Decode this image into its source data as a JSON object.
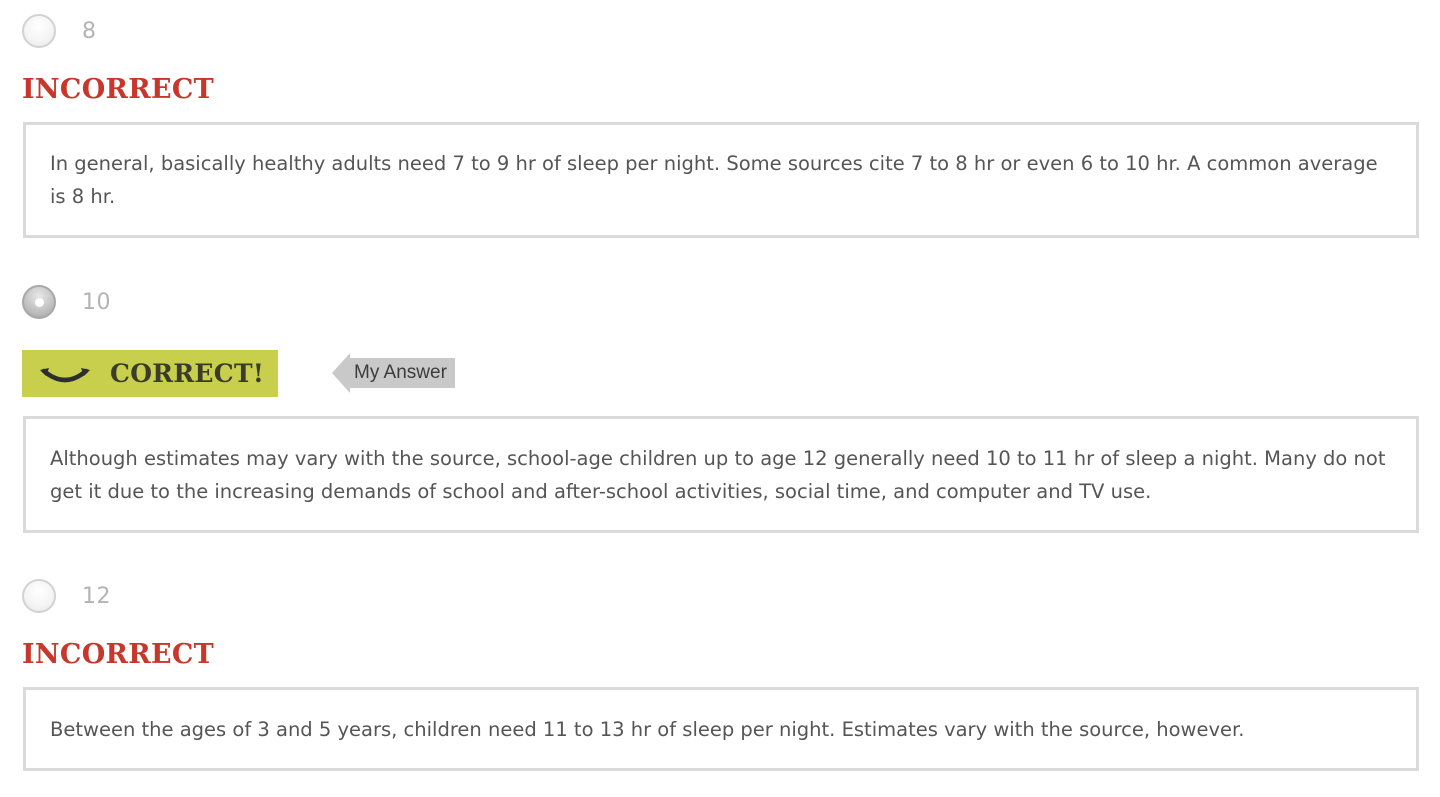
{
  "options": [
    {
      "label": "8",
      "selected": false,
      "result": "INCORRECT",
      "feedback": "In general, basically healthy adults need 7 to 9 hr of sleep per night. Some sources cite 7 to 8 hr or even 6 to 10 hr. A common average is 8 hr."
    },
    {
      "label": "10",
      "selected": true,
      "result": "CORRECT!",
      "my_answer_tag": "My Answer",
      "feedback": "Although estimates may vary with the source, school-age children up to age 12 generally need 10 to 11 hr of sleep a night. Many do not get it due to the increasing demands of school and after-school activities, social time, and computer and TV use."
    },
    {
      "label": "12",
      "selected": false,
      "result": "INCORRECT",
      "feedback": "Between the ages of 3 and 5 years, children need 11 to 13 hr of sleep per night. Estimates vary with the source, however."
    }
  ],
  "colors": {
    "incorrect": "#c8372c",
    "correct_bg": "#c7cf4c",
    "tag_bg": "#c9c9c9",
    "box_border": "#dadada"
  },
  "icons": {
    "correct": "smile-icon",
    "my_answer": "arrow-left-icon"
  }
}
